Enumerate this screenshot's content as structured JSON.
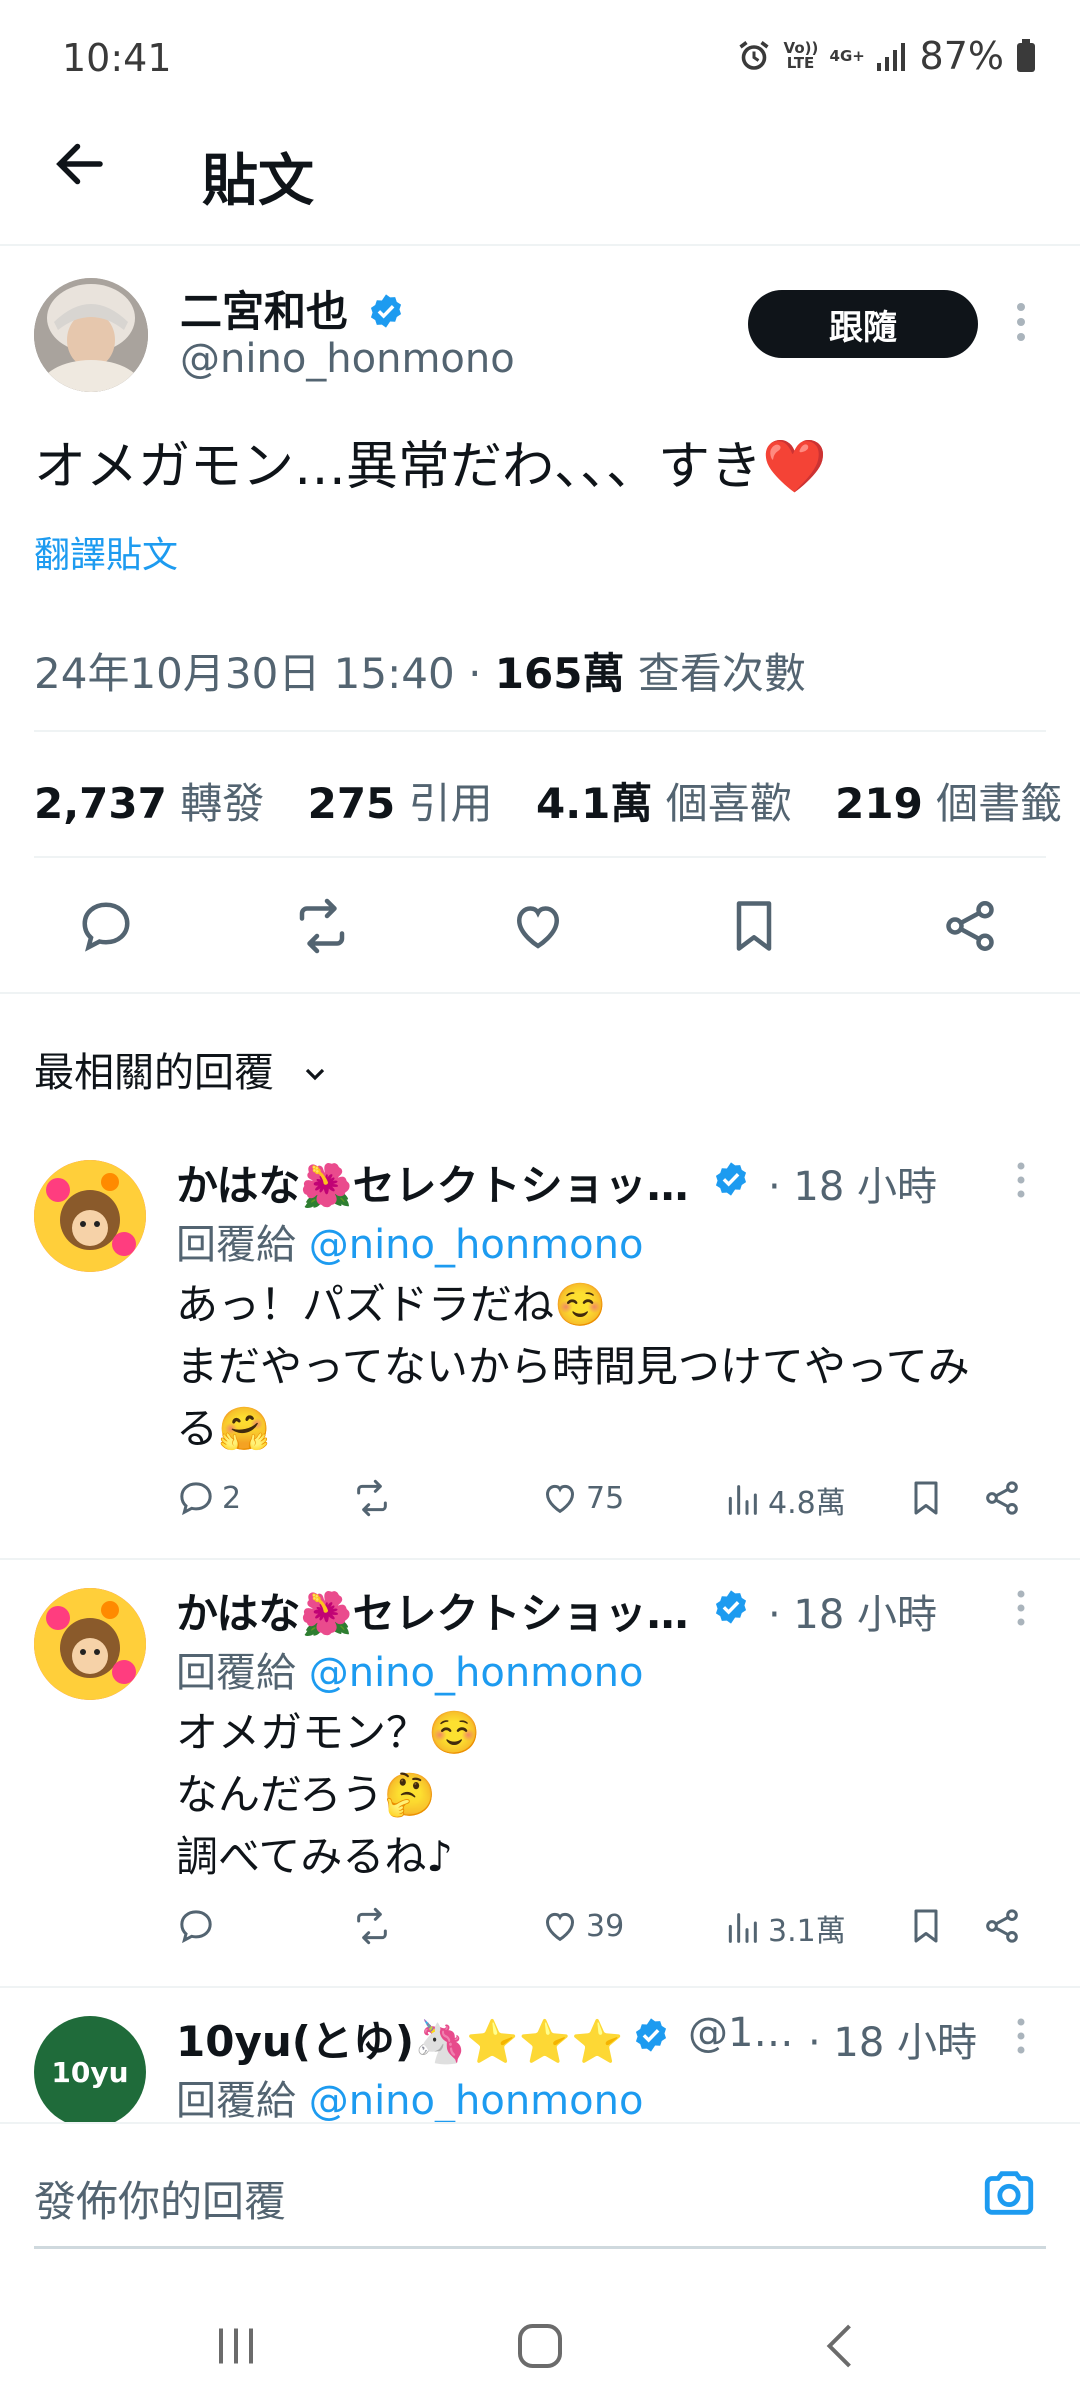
{
  "status_bar": {
    "time": "10:41",
    "volte": "Vo)) LTE",
    "network": "4G+",
    "battery": "87%"
  },
  "header": {
    "title": "貼文"
  },
  "post": {
    "author_name": "二宮和也",
    "author_handle": "@nino_honmono",
    "follow_label": "跟隨",
    "text": "オメガモン…異常だわ、、、すき❤️",
    "translate_label": "翻譯貼文",
    "date": "24年10月30日 15:40",
    "dot": "·",
    "views_count": "165萬",
    "views_label": "查看次數",
    "stats": {
      "reposts_count": "2,737",
      "reposts_label": "轉發",
      "quotes_count": "275",
      "quotes_label": "引用",
      "likes_count": "4.1萬",
      "likes_label": "個喜歡",
      "bookmarks_count": "219",
      "bookmarks_label": "個書籤"
    }
  },
  "replies_sort": {
    "label": "最相關的回覆"
  },
  "replies": [
    {
      "name": "かはな🌺セレクトショッ…",
      "time": "· 18 小時",
      "reply_to_prefix": "回覆給",
      "reply_to_handle": "@nino_honmono",
      "text_lines": [
        "あっ！パズドラだね☺️",
        "まだやってないから時間見つけてやってみ",
        "る🤗"
      ],
      "comments": "2",
      "likes": "75",
      "views": "4.8萬"
    },
    {
      "name": "かはな🌺セレクトショッ…",
      "time": "· 18 小時",
      "reply_to_prefix": "回覆給",
      "reply_to_handle": "@nino_honmono",
      "text_lines": [
        "オメガモン？☺️",
        "なんだろう🤔",
        "調べてみるね♪"
      ],
      "comments": "",
      "likes": "39",
      "views": "3.1萬"
    },
    {
      "name": "10yu(とゆ)🦄⭐⭐⭐",
      "handle": "@1…",
      "time": "· 18 小時",
      "reply_to_prefix": "回覆給",
      "reply_to_handle": "@nino_honmono",
      "avatar_text": "10yu"
    }
  ],
  "compose": {
    "placeholder": "發佈你的回覆"
  },
  "colors": {
    "accent": "#1d9bf0",
    "text": "#0f1419",
    "muted": "#536471",
    "divider": "#eff3f4",
    "heart": "#f91880"
  }
}
